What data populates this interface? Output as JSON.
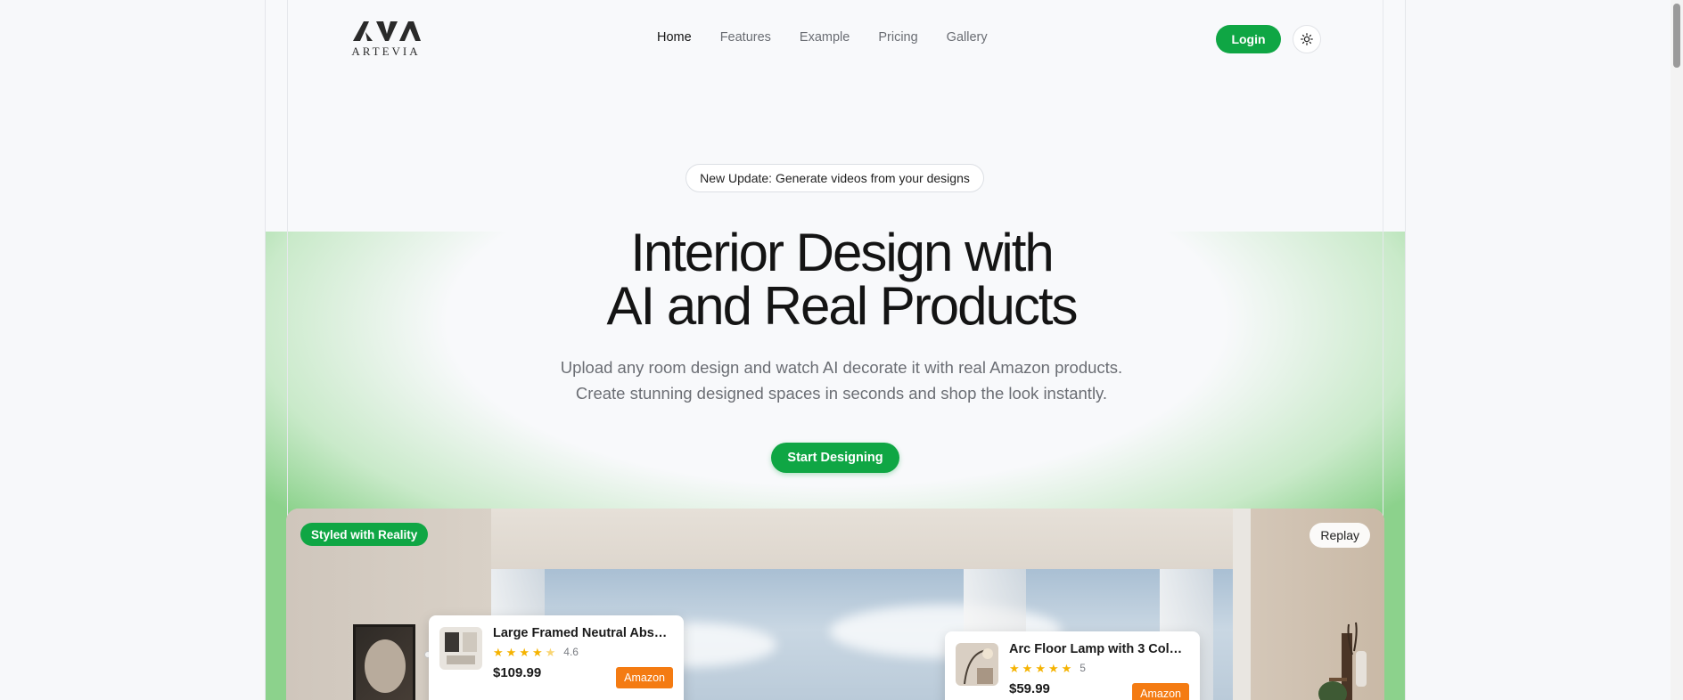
{
  "brand": {
    "name": "ARTEVIA",
    "mark": "AVA"
  },
  "nav": {
    "items": [
      {
        "label": "Home",
        "active": true
      },
      {
        "label": "Features",
        "active": false
      },
      {
        "label": "Example",
        "active": false
      },
      {
        "label": "Pricing",
        "active": false
      },
      {
        "label": "Gallery",
        "active": false
      }
    ]
  },
  "header": {
    "login_label": "Login",
    "theme_icon": "sun-icon"
  },
  "hero": {
    "badge": "New Update: Generate videos from your designs",
    "headline_line1": "Interior Design with",
    "headline_line2": "AI and Real Products",
    "subtitle_line1": "Upload any room design and watch AI decorate it with real Amazon products.",
    "subtitle_line2": "Create stunning designed spaces in seconds and shop the look instantly.",
    "cta_label": "Start Designing"
  },
  "showcase": {
    "tag": "Styled with Reality",
    "replay_label": "Replay",
    "products": [
      {
        "title": "Large Framed Neutral Abstr...",
        "rating": "4.6",
        "stars": 4.5,
        "price": "$109.99",
        "store": "Amazon"
      },
      {
        "title": "Arc Floor Lamp with 3 Color ...",
        "rating": "5",
        "stars": 5,
        "price": "$59.99",
        "store": "Amazon"
      }
    ]
  },
  "colors": {
    "accent": "#0fa644",
    "amazon": "#f47b12",
    "star": "#f5b301"
  }
}
